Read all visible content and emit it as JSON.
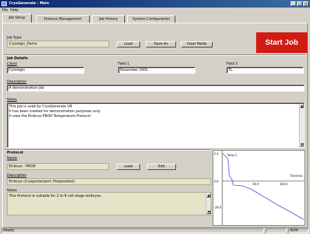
{
  "window": {
    "title": "CryoGenerate - Main",
    "controls": [
      "_",
      "□",
      "×"
    ]
  },
  "menu": [
    "File",
    "Help"
  ],
  "tabs": [
    "Job Setup",
    "Protocol Management",
    "Job History",
    "System Configuration"
  ],
  "job_type": {
    "label": "Job Type",
    "value": "Cryologic_Demo",
    "buttons": [
      "Load",
      "Save As",
      "Clear Fields"
    ]
  },
  "start_job": "Start Job",
  "job_details": {
    "header": "Job Details",
    "client_label": "Client",
    "client_value": "Cyrologic",
    "field1_label": "Field 1",
    "field1_value": "November 2001",
    "field2_label": "Field 2",
    "field2_value": "TL",
    "description_label": "Description",
    "description_value": "A demonstration Job",
    "notes_label": "Notes",
    "notes_lines": [
      "This Job is used by CryoGenerate VR",
      "It has been created for demonstration purposes only.",
      "It uses the Embryo PROH Temperature Protocol"
    ]
  },
  "protocol": {
    "header": "Protocol",
    "name_label": "Name",
    "name_value": "Embryo - PROH",
    "buttons": [
      "Load",
      "Edit"
    ],
    "description_label": "Description",
    "description_value": "Embryo (Cryoprotectant: Propanediol)",
    "notes_label": "Notes",
    "notes_value": "This Protocol is suitable for 2 to 8 cell stage embryos."
  },
  "graph": {
    "y_axis_title": "Temp C",
    "x_axis_title": "Time/min",
    "y_ticks": [
      "0.0",
      "-29.0"
    ],
    "y_top_tick": "5.0",
    "x_ticks": [
      "50.0",
      "100.0"
    ],
    "line_color": "#2b3fd6"
  },
  "status": {
    "left": "Ready",
    "right": "NUM"
  },
  "colors": {
    "title_bar": "#0a246a",
    "start_button": "#d21b12",
    "readonly_field": "#e4e4c8"
  }
}
